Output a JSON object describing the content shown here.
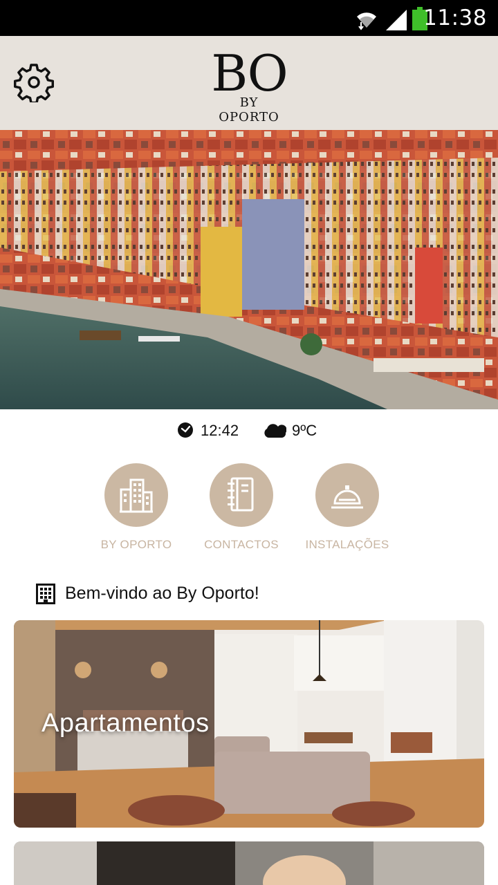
{
  "status_bar": {
    "time": "11:38"
  },
  "header": {
    "logo_main": "BO",
    "logo_sub": "BY OPORTO"
  },
  "info": {
    "time": "12:42",
    "temperature": "9ºC"
  },
  "quick_actions": [
    {
      "label": "BY OPORTO",
      "icon": "buildings-icon"
    },
    {
      "label": "CONTACTOS",
      "icon": "notebook-icon"
    },
    {
      "label": "INSTALAÇÕES",
      "icon": "service-bell-icon"
    }
  ],
  "welcome": {
    "text": "Bem-vindo ao By Oporto!"
  },
  "cards": [
    {
      "title": "Apartamentos"
    }
  ],
  "colors": {
    "header_bg": "#e7e2dc",
    "accent": "#cbb8a3",
    "accent_text": "#c8b5a2"
  }
}
